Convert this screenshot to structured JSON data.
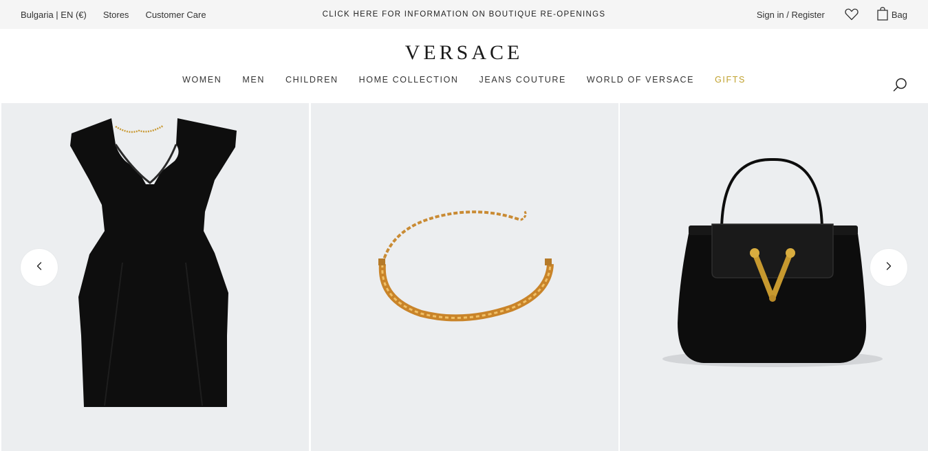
{
  "topbar": {
    "locale": "Bulgaria | EN (€)",
    "stores": "Stores",
    "customer_care": "Customer Care",
    "announcement": "CLICK HERE FOR INFORMATION ON BOUTIQUE RE-OPENINGS",
    "sign_in": "Sign in / Register",
    "wishlist_icon": "heart-icon",
    "bag_label": "Bag",
    "bag_icon": "shopping-bag-icon"
  },
  "header": {
    "logo": "VERSACE",
    "search_icon": "search-icon"
  },
  "nav": {
    "items": [
      {
        "label": "WOMEN"
      },
      {
        "label": "MEN"
      },
      {
        "label": "CHILDREN"
      },
      {
        "label": "HOME COLLECTION"
      },
      {
        "label": "JEANS COUTURE"
      },
      {
        "label": "WORLD OF VERSACE"
      },
      {
        "label": "GIFTS",
        "color": "#c0a12c"
      }
    ]
  },
  "carousel": {
    "products": [
      {
        "image": "black sleeveless mini dress with gold chain"
      },
      {
        "image": "gold chain choker necklace"
      },
      {
        "image": "black leather top-handle bag with gold V clasp"
      }
    ],
    "prev_icon": "chevron-left-icon",
    "next_icon": "chevron-right-icon"
  },
  "colors": {
    "topbar_bg": "#f5f5f5",
    "tile_bg": "#eceef0",
    "accent_gold": "#c0a12c"
  }
}
